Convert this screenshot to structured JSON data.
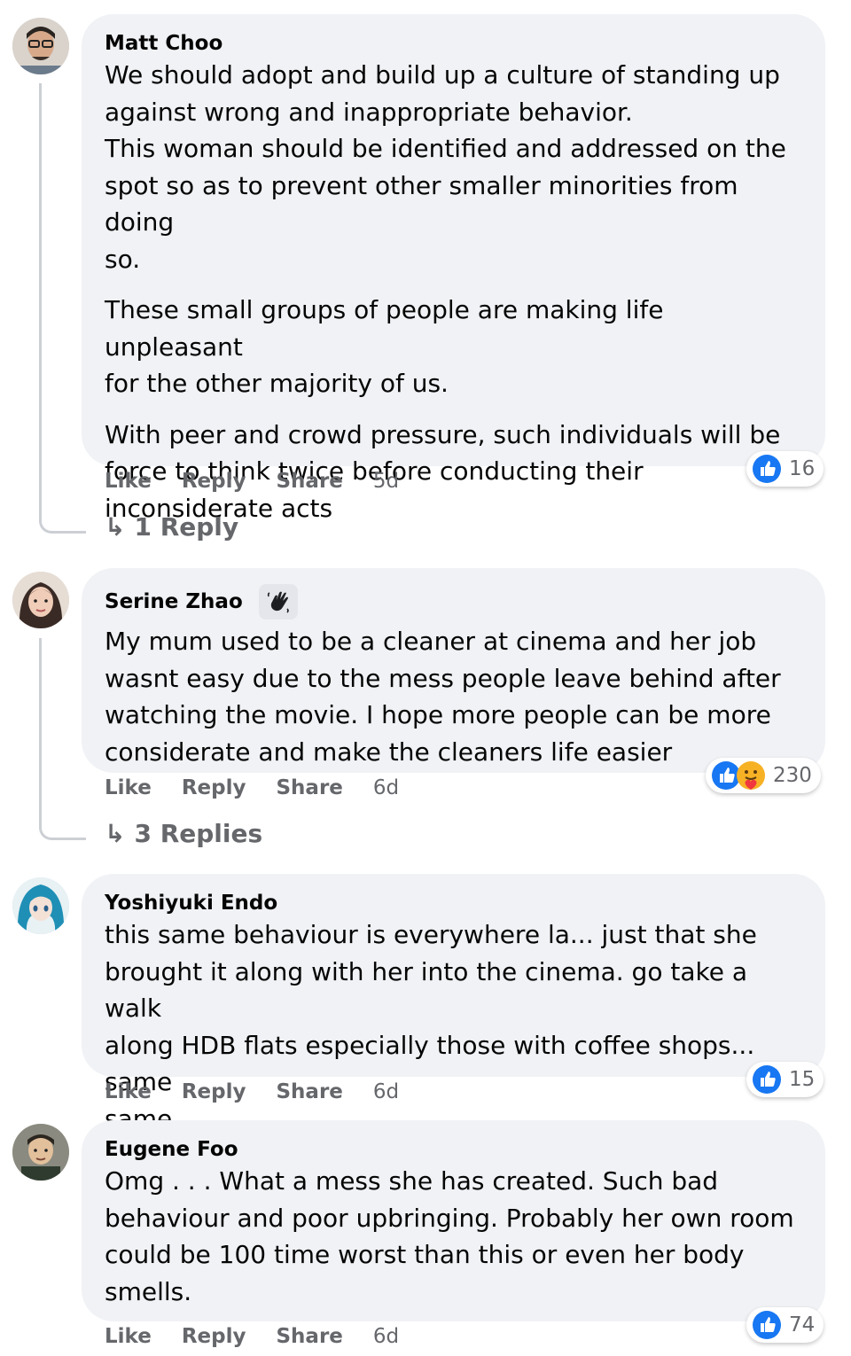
{
  "comments": [
    {
      "author": "Matt Choo",
      "paragraphs": [
        "We should adopt and build up a culture of standing up\nagainst wrong and inappropriate behavior.\nThis woman should be identified and addressed on the\nspot so as to prevent other smaller minorities from doing\nso.",
        "These small groups of people are making life unpleasant\nfor the other majority of us.",
        "With peer and crowd pressure, such individuals will be\nforce to think twice before conducting their\ninconsiderate acts"
      ],
      "actions": {
        "like": "Like",
        "reply": "Reply",
        "share": "Share",
        "age": "5d"
      },
      "reaction_count": "16",
      "reaction_icons": [
        "like-icon"
      ],
      "replies_label": "1 Reply"
    },
    {
      "author": "Serine Zhao",
      "badge_icon": "waving-hand-icon",
      "paragraphs": [
        "My mum used to be a cleaner at cinema and her job\nwasnt easy due to the mess people leave behind after\nwatching the movie. I hope more people can be more\nconsiderate and make the cleaners life easier"
      ],
      "actions": {
        "like": "Like",
        "reply": "Reply",
        "share": "Share",
        "age": "6d"
      },
      "reaction_count": "230",
      "reaction_icons": [
        "like-icon",
        "care-icon"
      ],
      "replies_label": "3 Replies"
    },
    {
      "author": "Yoshiyuki Endo",
      "paragraphs": [
        "this same behaviour is everywhere la... just that she\nbrought it along with her into the cinema. go take a walk\nalong HDB flats especially those with coffee shops... same\nsame"
      ],
      "actions": {
        "like": "Like",
        "reply": "Reply",
        "share": "Share",
        "age": "6d"
      },
      "reaction_count": "15",
      "reaction_icons": [
        "like-icon"
      ]
    },
    {
      "author": "Eugene Foo",
      "paragraphs": [
        "Omg . . . What a mess she has created. Such bad\nbehaviour and poor upbringing. Probably her own room\ncould be 100 time worst than this or even her body\nsmells."
      ],
      "actions": {
        "like": "Like",
        "reply": "Reply",
        "share": "Share",
        "age": "6d"
      },
      "reaction_count": "74",
      "reaction_icons": [
        "like-icon"
      ]
    }
  ],
  "colors": {
    "bubble": "#f0f2f5",
    "like_blue": "#1877f2",
    "secondary_text": "#65676b"
  }
}
